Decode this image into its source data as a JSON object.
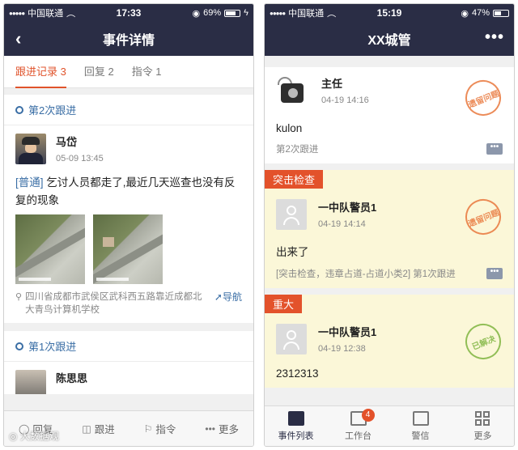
{
  "left": {
    "status": {
      "carrier": "中国联通",
      "time": "17:33",
      "battery": "69%",
      "battery_level": 0.69
    },
    "nav": {
      "title": "事件详情",
      "back_glyph": "‹"
    },
    "tabs": [
      {
        "label": "跟进记录 3",
        "active": true
      },
      {
        "label": "回复 2",
        "active": false
      },
      {
        "label": "指令 1",
        "active": false
      }
    ],
    "followup_2": {
      "heading": "第2次跟进",
      "name": "马岱",
      "date": "05-09 13:45",
      "tag": "[普通]",
      "text": "乞讨人员都走了,最近几天巡查也没有反复的现象",
      "location": "四川省成都市武侯区武科西五路靠近成都北大青鸟计算机学校",
      "nav_label": "导航"
    },
    "followup_1": {
      "heading": "第1次跟进",
      "name": "陈思思"
    },
    "bottom_bar": {
      "reply": "回复",
      "follow": "跟进",
      "command": "指令",
      "more": "更多"
    },
    "watermark": "大数据观"
  },
  "right": {
    "status": {
      "carrier": "中国联通",
      "time": "15:19",
      "battery": "47%",
      "battery_level": 0.47
    },
    "nav": {
      "title": "XX城管",
      "menu_glyph": "•••"
    },
    "cards": [
      {
        "tag": "",
        "name": "主任",
        "date": "04-19 14:16",
        "body": "kulon",
        "meta": "第2次跟进",
        "seal": "遗留问题",
        "seal_color": "#e9783d"
      },
      {
        "tag": "突击检查",
        "name": "一中队警员1",
        "date": "04-19 14:14",
        "body": "出来了",
        "meta": "[突击检查，违章占道-占道小类2] 第1次跟进",
        "seal": "遗留问题",
        "seal_color": "#e9783d"
      },
      {
        "tag": "重大",
        "name": "一中队警员1",
        "date": "04-19 12:38",
        "body": "2312313",
        "meta": "",
        "seal": "已解决",
        "seal_color": "#7fb540"
      }
    ],
    "more_chip": "•••",
    "tabbar": [
      {
        "label": "事件列表",
        "active": true,
        "badge": ""
      },
      {
        "label": "工作台",
        "active": false,
        "badge": "4"
      },
      {
        "label": "警信",
        "active": false,
        "badge": ""
      },
      {
        "label": "更多",
        "active": false,
        "badge": ""
      }
    ]
  }
}
